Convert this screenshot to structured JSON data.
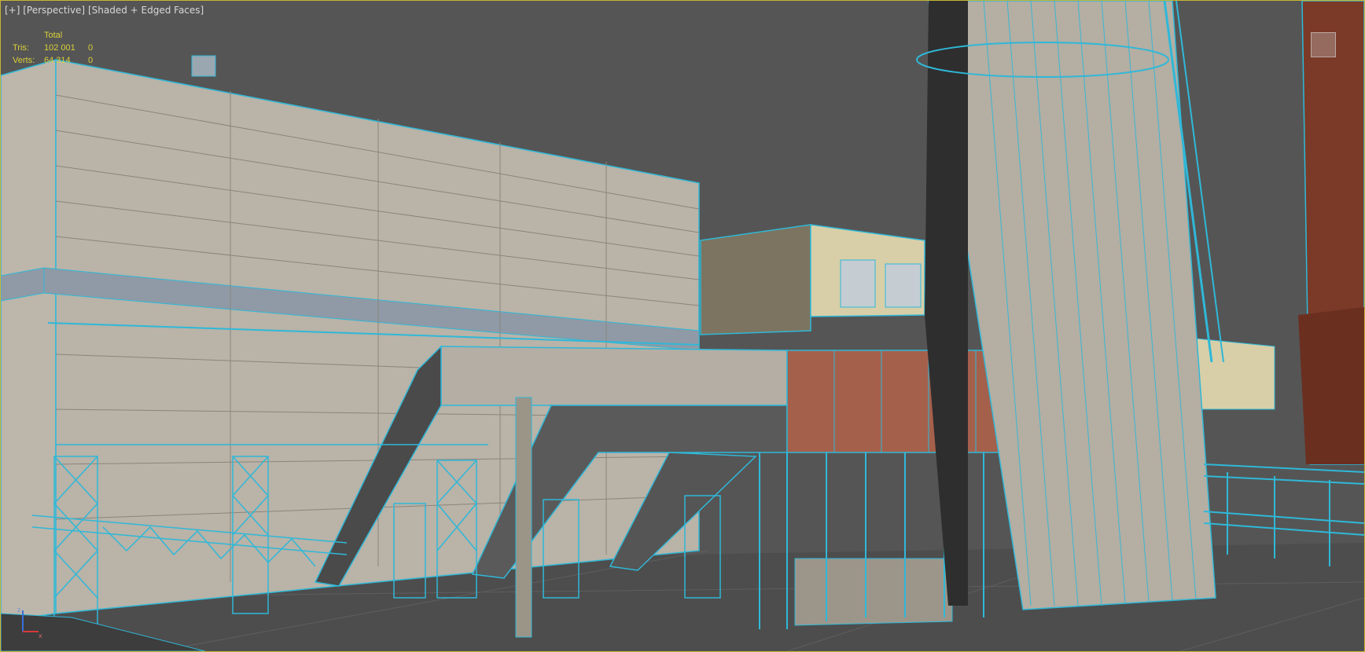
{
  "viewport": {
    "label_plus": "[+]",
    "label_view": "[Perspective]",
    "label_shading": "[Shaded + Edged Faces]"
  },
  "stats": {
    "header": "Total",
    "rows": [
      {
        "label": "Tris:",
        "total": "102 001",
        "selected": "0"
      },
      {
        "label": "Verts:",
        "total": "64 314",
        "selected": "0"
      }
    ]
  },
  "gizmo": {
    "x_axis": "x",
    "z_axis": "z"
  },
  "colors": {
    "viewport_bg": "#555555",
    "border_active": "#c9b536",
    "wireframe": "#2fb8d8",
    "stats_text": "#d9cf3a"
  }
}
